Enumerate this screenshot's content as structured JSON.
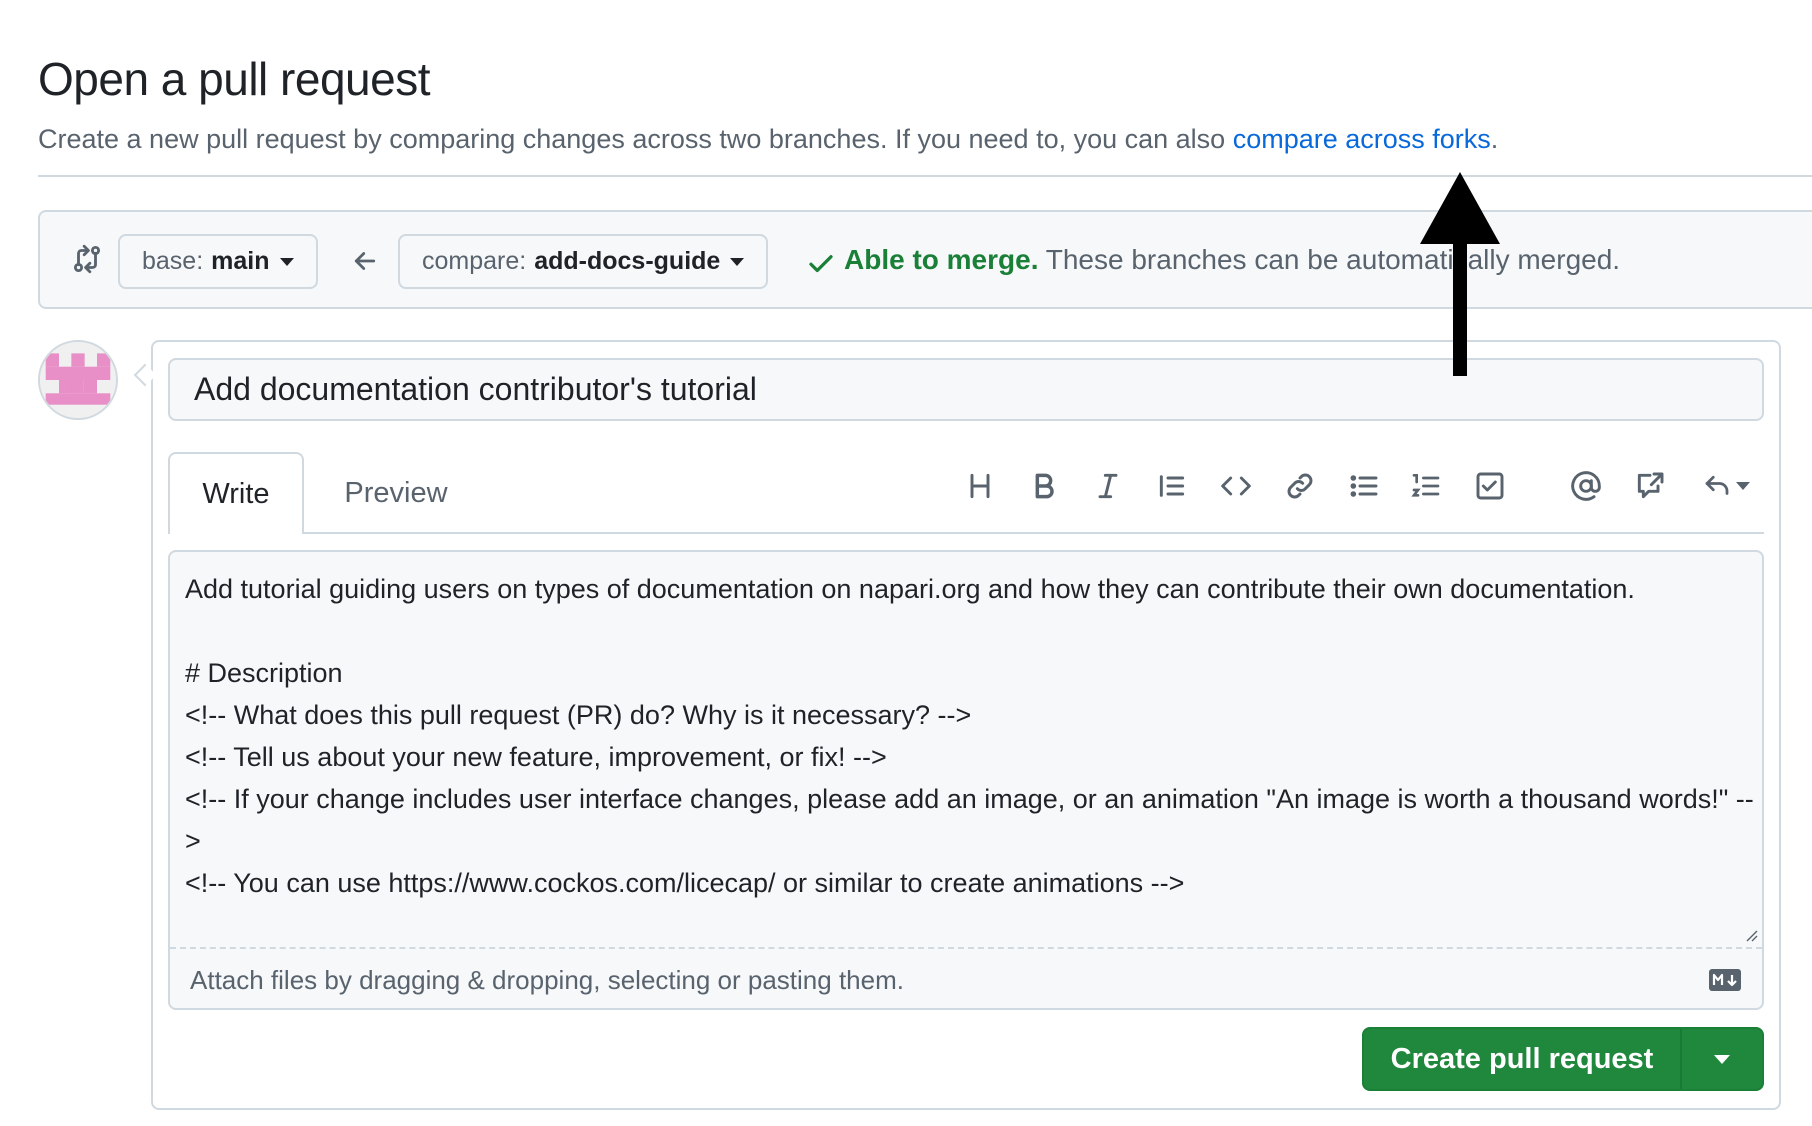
{
  "header": {
    "title": "Open a pull request",
    "subtitle": "Create a new pull request by comparing changes across two branches. If you need to, you can also ",
    "subtitle_link": "compare across forks",
    "subtitle_end": "."
  },
  "compare": {
    "base_prefix": "base:",
    "base_branch": "main",
    "compare_prefix": "compare:",
    "compare_branch": "add-docs-guide",
    "merge_status": "Able to merge.",
    "merge_detail": " These branches can be automatically merged."
  },
  "form": {
    "title_value": "Add documentation contributor's tutorial",
    "tabs": [
      "Write",
      "Preview"
    ],
    "toolbar_icons": [
      "heading-icon",
      "bold-icon",
      "italic-icon",
      "quote-icon",
      "code-icon",
      "link-icon",
      "unordered-list-icon",
      "ordered-list-icon",
      "task-list-icon",
      "mention-icon",
      "cross-reference-icon",
      "undo-icon"
    ],
    "body_value": "Add tutorial guiding users on types of documentation on napari.org and how they can contribute their own documentation.\n\n# Description\n<!-- What does this pull request (PR) do? Why is it necessary? -->\n<!-- Tell us about your new feature, improvement, or fix! -->\n<!-- If your change includes user interface changes, please add an image, or an animation \"An image is worth a thousand words!\" -->\n<!-- You can use https://www.cockos.com/licecap/ or similar to create animations -->",
    "attach_hint": "Attach files by dragging & dropping, selecting or pasting them.",
    "submit_label": "Create pull request"
  },
  "colors": {
    "accent_link": "#0969da",
    "success": "#1a7f37",
    "button_green": "#1f883d",
    "avatar_pink": "#e78fc6"
  }
}
